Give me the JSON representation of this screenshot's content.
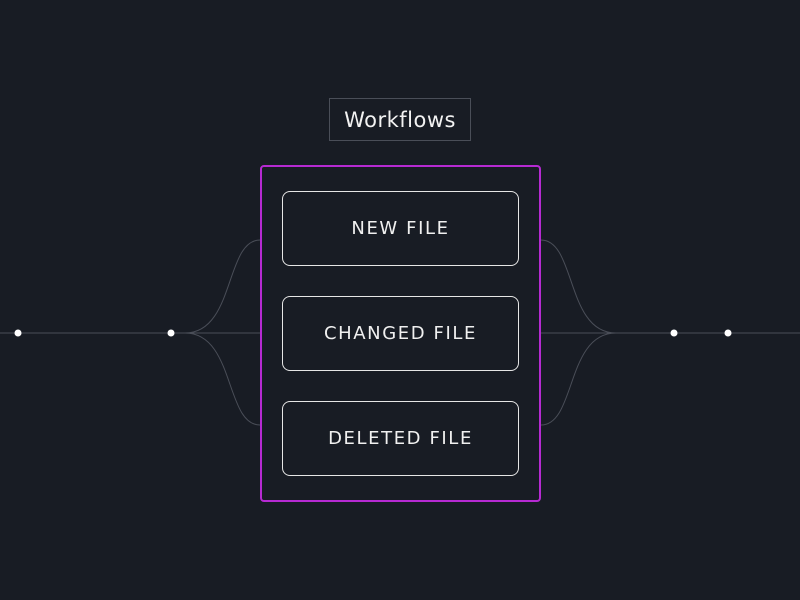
{
  "title": "Workflows",
  "workflows": [
    {
      "label": "NEW FILE"
    },
    {
      "label": "CHANGED FILE"
    },
    {
      "label": "DELETED FILE"
    }
  ],
  "colors": {
    "background": "#181c24",
    "group_border": "#b62ad2",
    "box_border": "#e6e6e6",
    "line": "#4a4e58",
    "node": "#ffffff"
  }
}
